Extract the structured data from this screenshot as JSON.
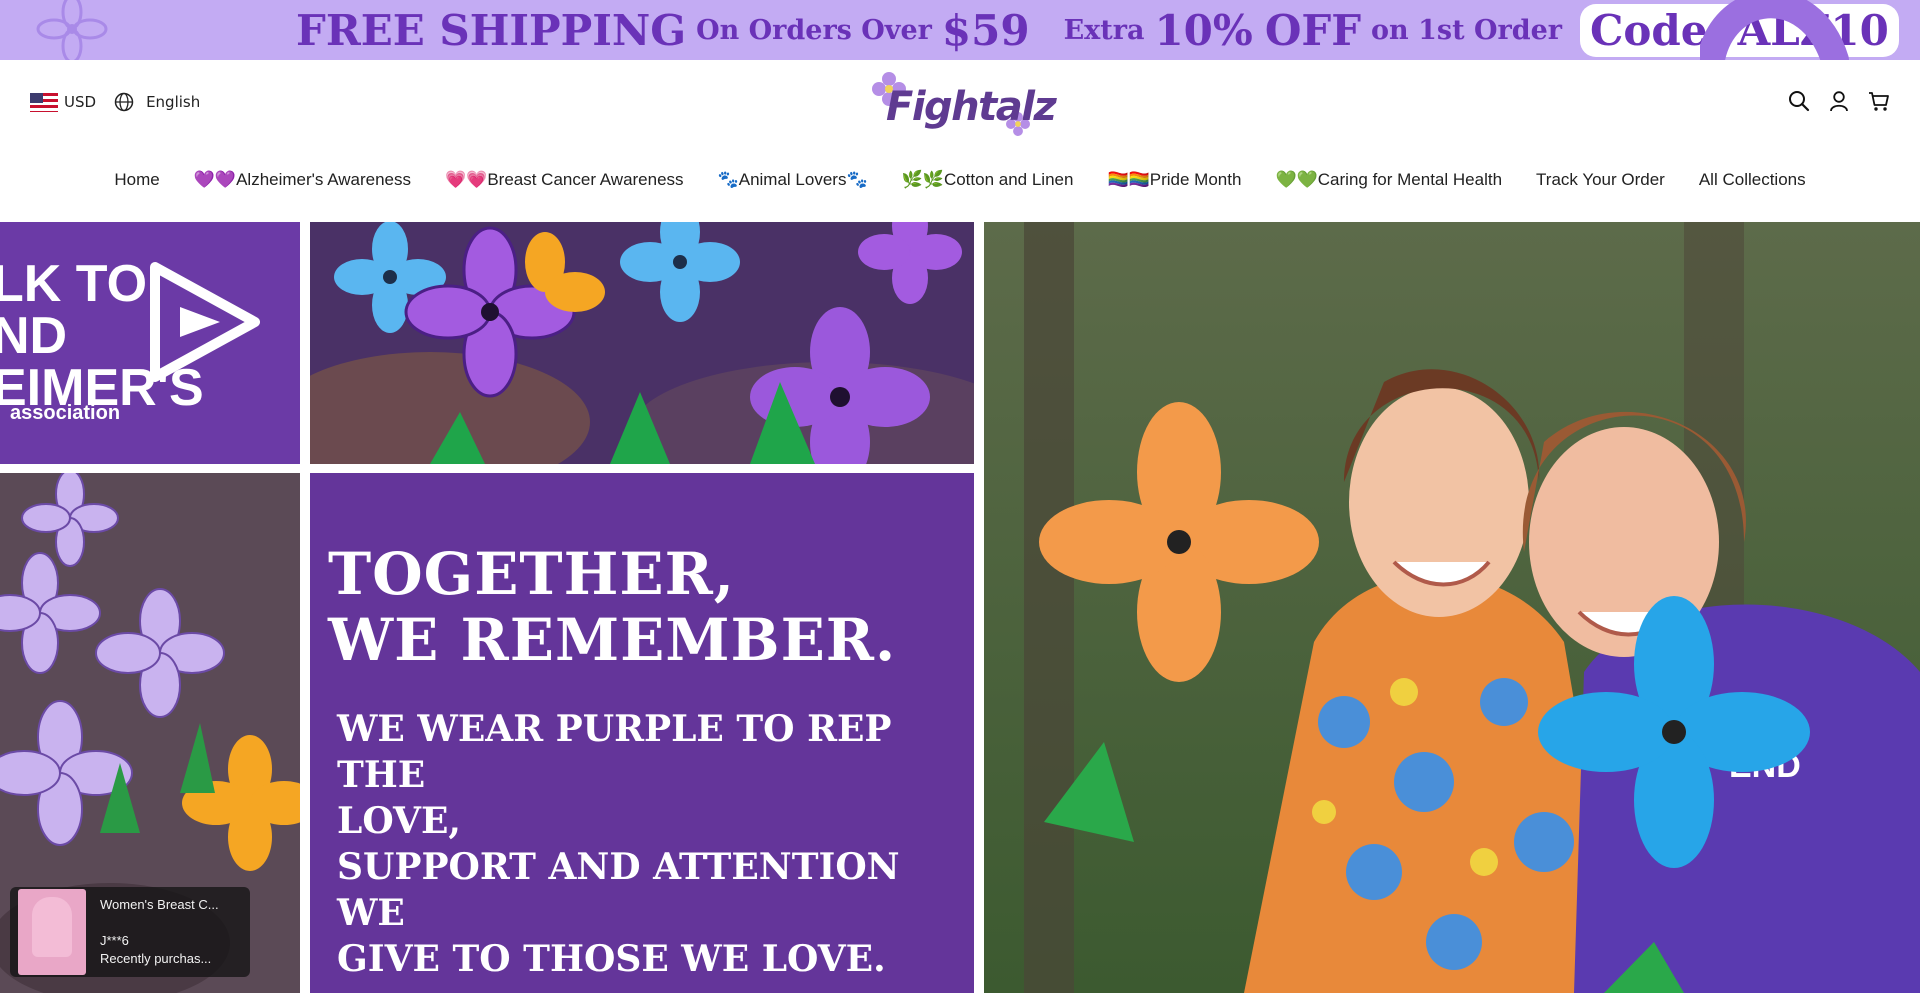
{
  "announcement": {
    "part1": "FREE SHIPPING",
    "part2": "On Orders Over",
    "part3": "$59",
    "part4": "Extra",
    "part5": "10%",
    "part6": "OFF",
    "part7": "on 1st Order",
    "code": "Code: ALZ10"
  },
  "header": {
    "currency": "USD",
    "language": "English",
    "logo_text": "Fightalz",
    "icons": [
      "search-icon",
      "account-icon",
      "cart-icon"
    ]
  },
  "nav": {
    "items": [
      "Home",
      "💜💜Alzheimer's Awareness",
      "💗💗Breast Cancer Awareness",
      "🐾Animal Lovers🐾",
      "🌿🌿Cotton and Linen",
      "🏳️‍🌈🏳️‍🌈Pride Month",
      "💚💚Caring for Mental Health",
      "Track Your Order",
      "All Collections"
    ]
  },
  "hero": {
    "walk_text": "LK TO\nND\nEIMER'S",
    "assoc_text": "association",
    "headline_1": "TOGETHER,",
    "headline_2": "WE REMEMBER.",
    "body_1": "WE WEAR PURPLE TO REP THE",
    "body_2": "LOVE,",
    "body_3": "SUPPORT AND ATTENTION WE",
    "body_4": "GIVE TO THOSE WE LOVE."
  },
  "popup": {
    "product": "Women's Breast C...",
    "buyer": "J***6",
    "status": "Recently purchas..."
  },
  "colors": {
    "announce_bg": "#c3abf3",
    "brand_purple": "#6a32b8",
    "hero_purple": "#64359a"
  }
}
